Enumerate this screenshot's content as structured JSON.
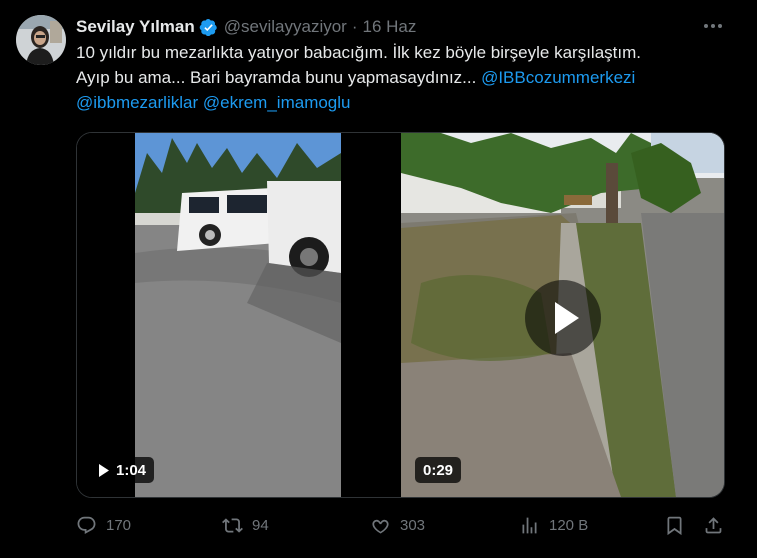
{
  "author": {
    "name": "Sevilay Yılman",
    "handle": "@sevilayyaziyor",
    "separator": "·",
    "date": "16 Haz"
  },
  "tweet": {
    "line1": "10 yıldır bu mezarlıkta yatıyor babacığım. İlk kez böyle birşeyle karşılaştım.",
    "line2_text": "Ayıp bu ama... Bari bayramda bunu yapmasaydınız... ",
    "mention1": "@IBBcozummerkezi",
    "mention2": "@ibbmezarliklar",
    "mention3": "@ekrem_imamoglu"
  },
  "media": {
    "video1_duration": "1:04",
    "video2_duration": "0:29"
  },
  "actions": {
    "replies": "170",
    "reposts": "94",
    "likes": "303",
    "views": "120 B"
  },
  "colors": {
    "background": "#000000",
    "text": "#e7e9ea",
    "muted": "#71767b",
    "link": "#1d9bf0",
    "verified": "#1d9bf0"
  }
}
